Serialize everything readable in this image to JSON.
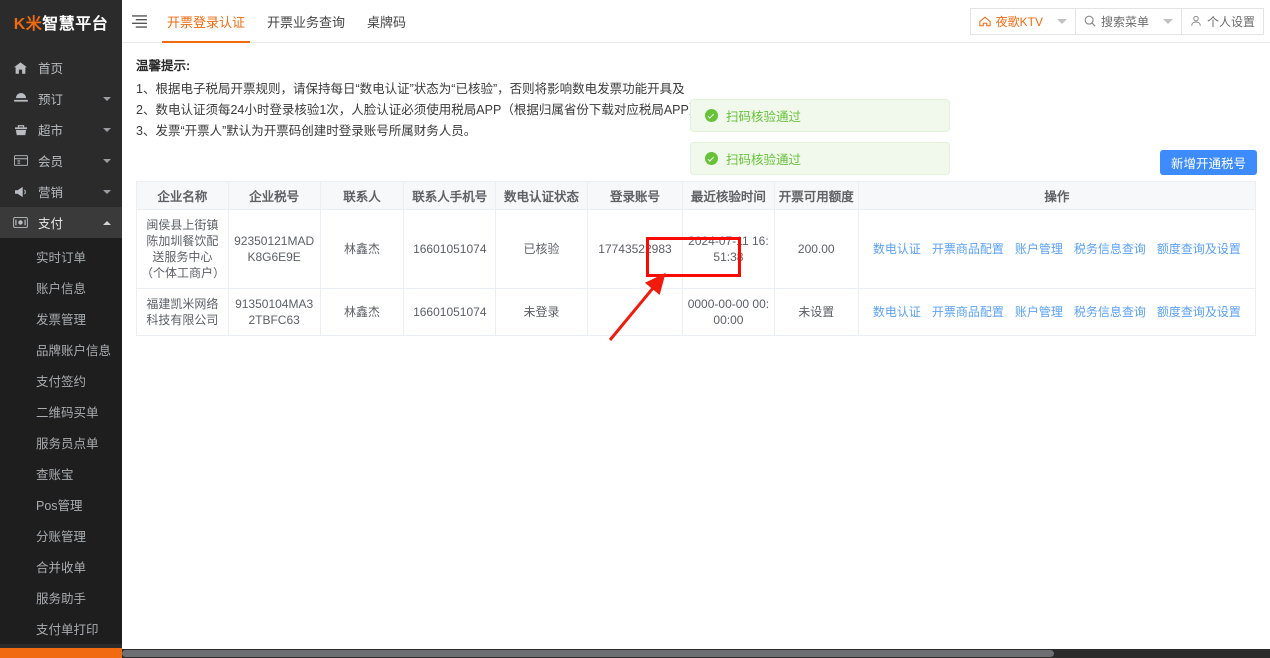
{
  "sidebar": {
    "logo_k": "K米",
    "logo_rest": "智慧平台",
    "items": [
      {
        "label": "首页",
        "icon": "home-icon",
        "has_caret": false
      },
      {
        "label": "预订",
        "icon": "booking-icon",
        "has_caret": true
      },
      {
        "label": "超市",
        "icon": "store-icon",
        "has_caret": true
      },
      {
        "label": "会员",
        "icon": "member-card-icon",
        "has_caret": true
      },
      {
        "label": "营销",
        "icon": "megaphone-icon",
        "has_caret": true
      },
      {
        "label": "支付",
        "icon": "payment-icon",
        "has_caret": true,
        "expanded": true
      }
    ],
    "submenu": [
      {
        "label": "实时订单"
      },
      {
        "label": "账户信息"
      },
      {
        "label": "发票管理"
      },
      {
        "label": "品牌账户信息"
      },
      {
        "label": "支付签约"
      },
      {
        "label": "二维码买单"
      },
      {
        "label": "服务员点单"
      },
      {
        "label": "查账宝"
      },
      {
        "label": "Pos管理"
      },
      {
        "label": "分账管理"
      },
      {
        "label": "合并收单"
      },
      {
        "label": "服务助手"
      },
      {
        "label": "支付单打印"
      }
    ]
  },
  "topbar": {
    "menu_toggle_icon": "hamburger-icon",
    "tabs": [
      {
        "label": "开票登录认证",
        "active": true
      },
      {
        "label": "开票业务查询",
        "active": false
      },
      {
        "label": "桌牌码",
        "active": false
      }
    ],
    "store_selector": {
      "icon": "home-outline-icon",
      "label": "夜歌KTV",
      "caret": "chevron-down-icon"
    },
    "search_menu": {
      "icon": "search-icon",
      "placeholder": "搜索菜单",
      "value": "搜索菜单",
      "caret": "chevron-down-icon"
    },
    "personal_settings": {
      "icon": "user-icon",
      "label": "个人设置"
    }
  },
  "tips": {
    "title": "温馨提示:",
    "lines": [
      "1、根据电子税局开票规则，请保持每日“数电认证”状态为“已核验”，否则将影响数电发票功能开具及",
      "2、数电认证须每24小时登录核验1次，人脸认证必须使用税局APP（根据归属省份下载对应税局APP）进行扫码认证",
      "3、发票“开票人”默认为开票码创建时登录账号所属财务人员。"
    ]
  },
  "toasts": [
    {
      "icon": "success-check-icon",
      "text": "扫码核验通过"
    },
    {
      "icon": "success-check-icon",
      "text": "扫码核验通过"
    }
  ],
  "actions": {
    "add_tax_number_label": "新增开通税号"
  },
  "table": {
    "columns": [
      "企业名称",
      "企业税号",
      "联系人",
      "联系人手机号",
      "数电认证状态",
      "登录账号",
      "最近核验时间",
      "开票可用额度",
      "操作"
    ],
    "rows": [
      {
        "company": "闽侯县上街镇陈加圳餐饮配送服务中心（个体工商户）",
        "tax_no": "92350121MADK8G6E9E",
        "contact": "林鑫杰",
        "phone": "16601051074",
        "auth_status": "已核验",
        "login_account": "17743522983",
        "last_verify_time": "2024-07-11 16:51:38",
        "quota": "200.00",
        "ops": [
          "数电认证",
          "开票商品配置",
          "账户管理",
          "税务信息查询",
          "额度查询及设置"
        ]
      },
      {
        "company": "福建凯米网络科技有限公司",
        "tax_no": "91350104MA32TBFC63",
        "contact": "林鑫杰",
        "phone": "16601051074",
        "auth_status": "未登录",
        "login_account": "",
        "last_verify_time": "0000-00-00 00:00:00",
        "quota": "未设置",
        "ops": [
          "数电认证",
          "开票商品配置",
          "账户管理",
          "税务信息查询",
          "额度查询及设置"
        ]
      }
    ]
  },
  "annotations": {
    "highlight_box": {
      "target": "已核验",
      "color": "#fb0a02"
    },
    "arrow": {
      "color": "#f01b0c"
    }
  },
  "colors": {
    "brand_orange": "#f26a0f",
    "sidebar_bg": "#2b2b2b",
    "submenu_bg": "#1e1e1e",
    "link_blue": "#5aa1f7",
    "button_blue": "#3d8bfd",
    "success_green": "#67c23a",
    "annotation_red": "#fb0a02"
  }
}
